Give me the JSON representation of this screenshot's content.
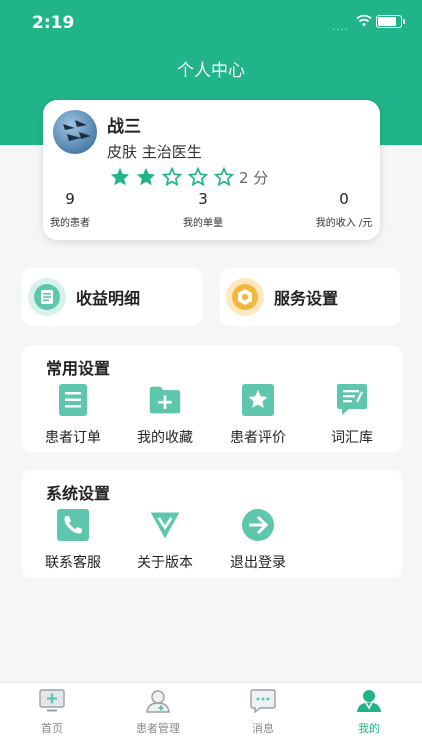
{
  "status_bar": {
    "time": "2:19",
    "signal": "...."
  },
  "header": {
    "title": "个人中心"
  },
  "profile": {
    "name": "战三",
    "department_title": "皮肤 主治医生",
    "rating": {
      "score": 2,
      "max": 5,
      "label": "2 分"
    },
    "stats": [
      {
        "value": "9",
        "label": "我的患者"
      },
      {
        "value": "3",
        "label": "我的单量"
      },
      {
        "value": "0",
        "label": "我的收入 /元"
      }
    ]
  },
  "quick_actions": [
    {
      "label": "收益明细",
      "icon": "receipt-icon"
    },
    {
      "label": "服务设置",
      "icon": "hexagon-gear-icon"
    }
  ],
  "common_settings": {
    "title": "常用设置",
    "items": [
      {
        "label": "患者订单",
        "icon": "order-list-icon"
      },
      {
        "label": "我的收藏",
        "icon": "folder-add-icon"
      },
      {
        "label": "患者评价",
        "icon": "star-box-icon"
      },
      {
        "label": "词汇库",
        "icon": "vocabulary-icon"
      }
    ]
  },
  "system_settings": {
    "title": "系统设置",
    "items": [
      {
        "label": "联系客服",
        "icon": "phone-icon"
      },
      {
        "label": "关于版本",
        "icon": "version-icon"
      },
      {
        "label": "退出登录",
        "icon": "logout-arrow-icon"
      }
    ]
  },
  "tabbar": {
    "items": [
      {
        "label": "首页",
        "icon": "monitor-plus-icon"
      },
      {
        "label": "患者管理",
        "icon": "patient-icon"
      },
      {
        "label": "消息",
        "icon": "message-icon"
      },
      {
        "label": "我的",
        "icon": "doctor-icon",
        "active": true
      }
    ]
  },
  "colors": {
    "primary": "#22b489",
    "icon_teal": "#5fc6ae",
    "service_orange": "#f4b63d"
  }
}
